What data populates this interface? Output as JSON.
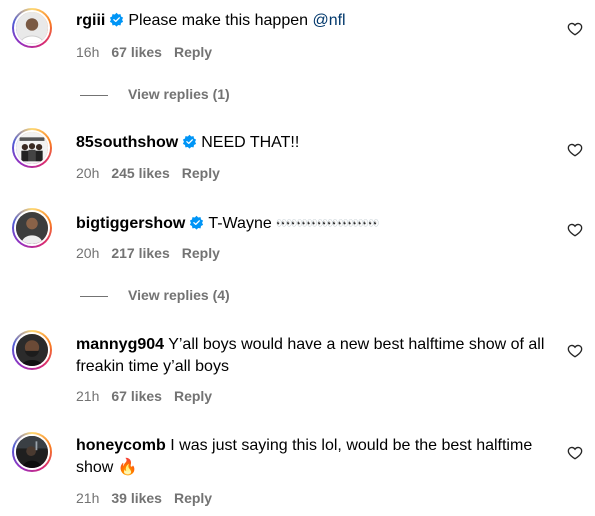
{
  "comments": [
    {
      "username": "rgiii",
      "verified": true,
      "text": "Please make this happen ",
      "mention": "@nfl",
      "time": "16h",
      "likes": "67 likes",
      "reply": "Reply",
      "view_replies": "View replies (1)"
    },
    {
      "username": "85southshow",
      "verified": true,
      "text": "NEED THAT!!",
      "time": "20h",
      "likes": "245 likes",
      "reply": "Reply"
    },
    {
      "username": "bigtiggershow",
      "verified": true,
      "text": "T-Wayne ",
      "emoji": "👀👀👀👀👀👀👀👀👀👀",
      "time": "20h",
      "likes": "217 likes",
      "reply": "Reply",
      "view_replies": "View replies (4)"
    },
    {
      "username": "mannyg904",
      "verified": false,
      "text": "Y’all boys would have a new best halftime show of all freakin time y’all boys",
      "time": "21h",
      "likes": "67 likes",
      "reply": "Reply"
    },
    {
      "username": "honeycomb",
      "verified": false,
      "text": "I was just saying this lol, would be the best halftime show ",
      "emoji": "🔥",
      "time": "21h",
      "likes": "39 likes",
      "reply": "Reply"
    }
  ],
  "icons": {
    "verified_badge": "verified-badge-icon",
    "like": "heart-outline-icon"
  },
  "colors": {
    "verified_blue": "#0095f6",
    "mention": "#00376b",
    "secondary_text": "#737373"
  }
}
